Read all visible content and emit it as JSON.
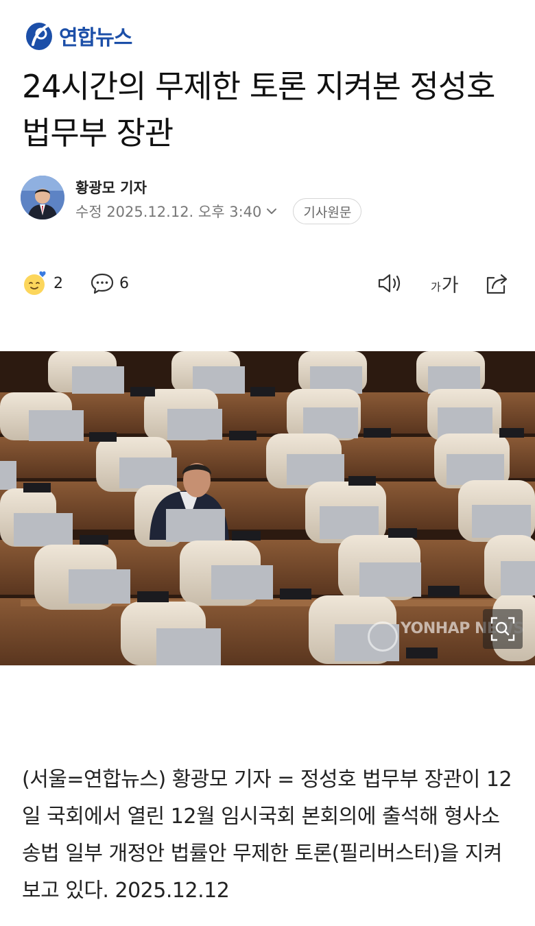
{
  "brand": {
    "name": "연합뉴스",
    "color": "#1c4fa8"
  },
  "article": {
    "title": "24시간의 무제한 토론 지켜본 정성호 법무부 장관",
    "author": "황광모 기자",
    "modified": "수정 2025.12.12. 오후 3:40",
    "original_button": "기사원문",
    "body": "(서울=연합뉴스) 황광모 기자 = 정성호 법무부 장관이 12일 국회에서 열린 12월 임시국회 본회의에 출석해 형사소송법 일부 개정안 법률안 무제한 토론(필리버스터)을 지켜보고 있다. 2025.12.12"
  },
  "actions": {
    "reaction_icon": "smile-heart-icon",
    "reaction_count": "2",
    "comment_icon": "comment-bubble-icon",
    "comment_count": "6",
    "speaker_icon": "speaker-icon",
    "fontsize_label_small": "가",
    "fontsize_label_large": "가",
    "share_icon": "share-icon"
  },
  "photo": {
    "watermark": "YONHAP NEWS",
    "zoom_icon": "zoom-icon"
  }
}
